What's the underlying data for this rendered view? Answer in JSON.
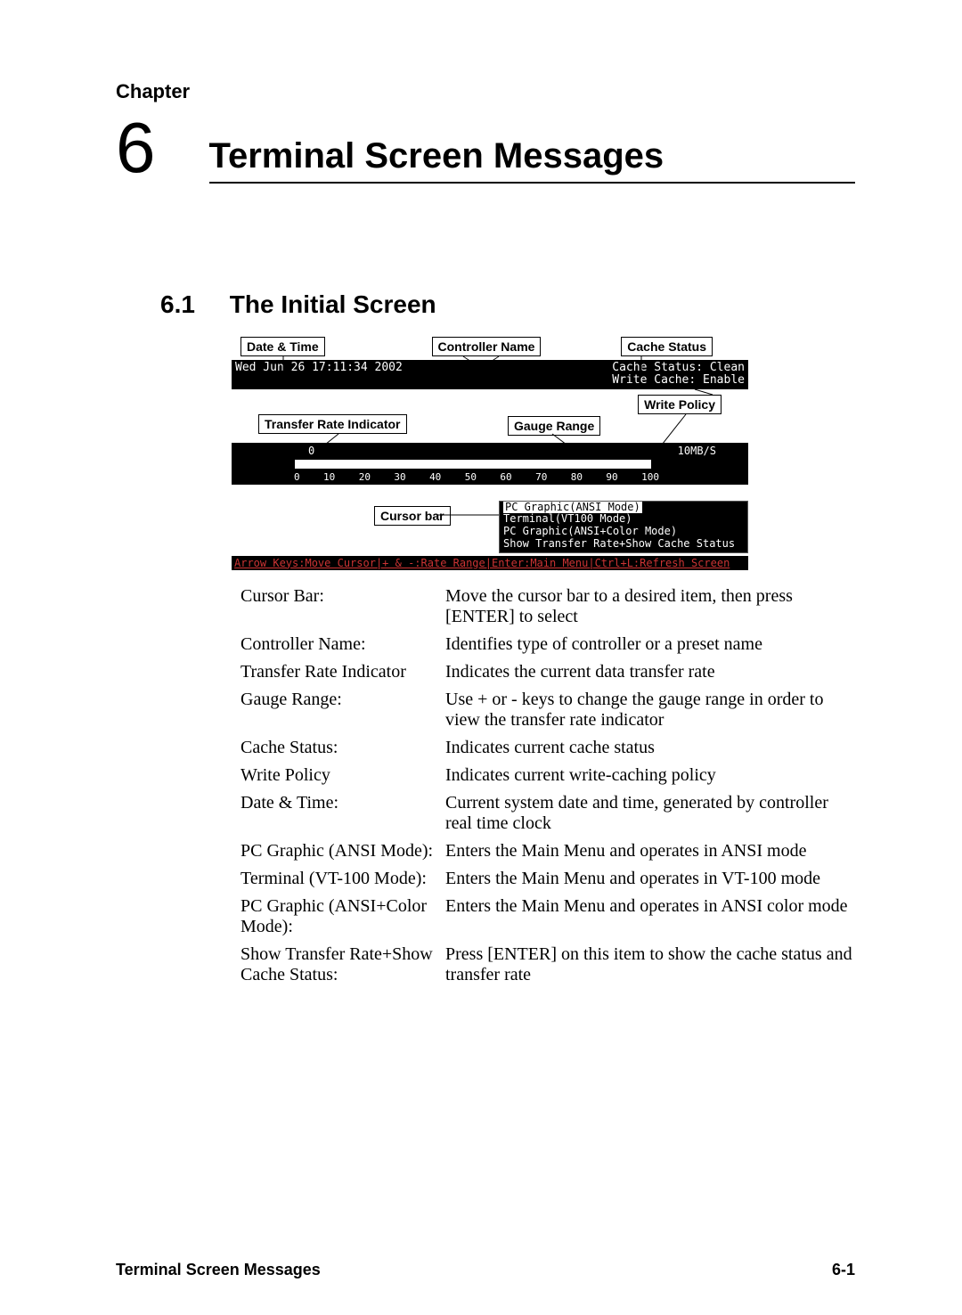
{
  "chapter": {
    "label": "Chapter",
    "number": "6",
    "title": "Terminal Screen Messages"
  },
  "section": {
    "number": "6.1",
    "title": "The Initial Screen"
  },
  "figure": {
    "callouts": {
      "date_time": "Date & Time",
      "controller_name": "Controller Name",
      "cache_status": "Cache Status",
      "transfer_rate_indicator": "Transfer Rate Indicator",
      "gauge_range": "Gauge Range",
      "write_policy": "Write Policy",
      "cursor_bar": "Cursor bar"
    },
    "terminal": {
      "datetime_text": "Wed Jun 26 17:11:34 2002",
      "cache_status_line": "Cache Status: Clean",
      "write_cache_line": "Write Cache: Enable",
      "gauge_start": "0",
      "gauge_unit": "10MB/S",
      "scale": [
        "0",
        "10",
        "20",
        "30",
        "40",
        "50",
        "60",
        "70",
        "80",
        "90",
        "100"
      ],
      "menu": {
        "opt1": "PC Graphic(ANSI Mode)",
        "opt2": "Terminal(VT100 Mode)",
        "opt3": "PC Graphic(ANSI+Color Mode)",
        "opt4": "Show Transfer Rate+Show Cache Status"
      },
      "hint": "Arrow Keys:Move Cursor|+ & -:Rate Range|Enter:Main Menu|Ctrl+L:Refresh Screen"
    }
  },
  "definitions": [
    {
      "term": "Cursor Bar:",
      "desc": "Move the cursor bar to a desired item, then press [ENTER] to select"
    },
    {
      "term": "Controller Name:",
      "desc": "Identifies type of controller or a preset name"
    },
    {
      "term": "Transfer Rate Indicator",
      "desc": "Indicates the current data transfer rate"
    },
    {
      "term": "Gauge Range:",
      "desc": "Use + or - keys to change the gauge range in order to view the transfer rate indicator"
    },
    {
      "term": "Cache Status:",
      "desc": "Indicates current cache status"
    },
    {
      "term": "Write Policy",
      "desc": "Indicates current write-caching policy"
    },
    {
      "term": "Date & Time:",
      "desc": "Current system date and time, generated by controller real time clock"
    },
    {
      "term": "PC Graphic (ANSI Mode):",
      "desc": "Enters the Main Menu and operates in ANSI mode"
    },
    {
      "term": "Terminal (VT-100 Mode):",
      "desc": "Enters the Main Menu and operates in VT-100 mode"
    },
    {
      "term": "PC Graphic (ANSI+Color Mode):",
      "desc": "Enters the Main Menu and operates in ANSI color mode"
    },
    {
      "term": "Show Transfer Rate+Show Cache Status:",
      "desc": "Press [ENTER] on this item to show the cache status and transfer rate"
    }
  ],
  "footer": {
    "left": "Terminal Screen Messages",
    "right": "6-1"
  }
}
